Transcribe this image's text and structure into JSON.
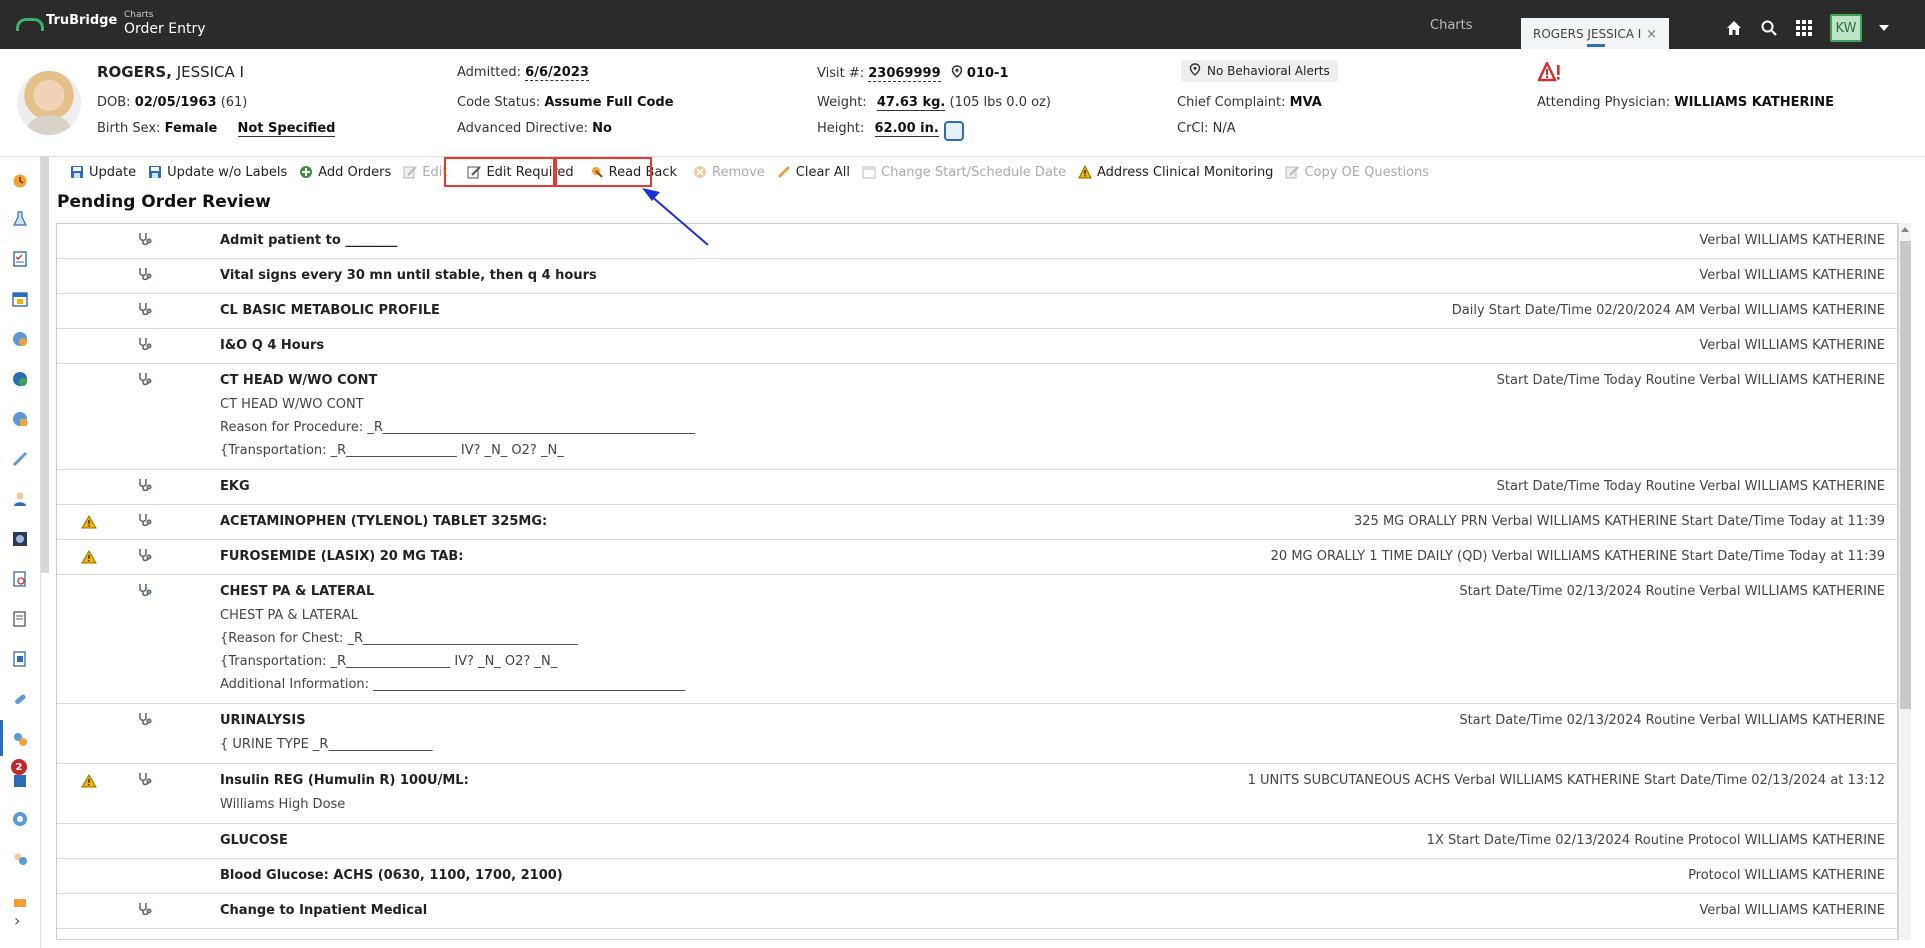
{
  "topbar": {
    "logo": "TruBridge",
    "crumb_small": "Charts",
    "crumb_main": "Order Entry",
    "tab_charts": "Charts",
    "tab_patient": "ROGERS JESSICA I",
    "tab_close": "×",
    "avatar_initials": "KW"
  },
  "patient": {
    "last_name": "ROGERS,",
    "first_name": " JESSICA I",
    "dob_label": "DOB:",
    "dob": "02/05/1963",
    "age": "(61)",
    "sex_label": "Birth Sex:",
    "sex": "Female",
    "gender": "Not Specified",
    "admitted_label": "Admitted:",
    "admitted": "6/6/2023",
    "code_status_label": "Code Status:",
    "code_status": "Assume Full Code",
    "adv_directive_label": "Advanced Directive:",
    "adv_directive": "No",
    "visit_label": "Visit #:",
    "visit": "23069999",
    "room": "010-1",
    "weight_label": "Weight:",
    "weight": "47.63 kg.",
    "weight_lbs": "(105 lbs 0.0 oz)",
    "height_label": "Height:",
    "height": "62.00 in.",
    "behavioral_alerts": "No Behavioral Alerts",
    "chief_complaint_label": "Chief Complaint:",
    "chief_complaint": "MVA",
    "crcl_label": "CrCl:",
    "crcl": "N/A",
    "attending_label": "Attending Physician:",
    "attending": "WILLIAMS KATHERINE"
  },
  "toolbar": {
    "update": "Update",
    "update_wo_labels": "Update w/o Labels",
    "add_orders": "Add Orders",
    "edit": "Edit",
    "edit_required": "Edit Required",
    "read_back": "Read Back",
    "remove": "Remove",
    "clear_all": "Clear All",
    "change_start": "Change Start/Schedule Date",
    "address_clinical": "Address Clinical Monitoring",
    "copy_oe": "Copy OE Questions"
  },
  "page_title": "Pending Order Review",
  "orders": [
    {
      "name": "Admit patient to ________",
      "detail": "Verbal WILLIAMS KATHERINE",
      "warn": false,
      "icon": true,
      "sub": []
    },
    {
      "name": "Vital signs every 30 mn until stable, then q 4 hours",
      "detail": "Verbal WILLIAMS KATHERINE",
      "warn": false,
      "icon": true,
      "sub": []
    },
    {
      "name": "CL BASIC METABOLIC PROFILE",
      "detail": "Daily Start Date/Time 02/20/2024 AM Verbal WILLIAMS KATHERINE",
      "warn": false,
      "icon": true,
      "sub": []
    },
    {
      "name": "I&O Q 4 Hours",
      "detail": "Verbal WILLIAMS KATHERINE",
      "warn": false,
      "icon": true,
      "sub": []
    },
    {
      "name": "CT HEAD W/WO CONT",
      "detail": "Start Date/Time Today Routine Verbal WILLIAMS KATHERINE",
      "warn": false,
      "icon": true,
      "sub": [
        "CT HEAD W/WO CONT",
        "Reason for Procedure: _R________________________________________________",
        "{Transportation: _R_________________ IV? _N_ O2? _N_"
      ]
    },
    {
      "name": "EKG",
      "detail": "Start Date/Time Today Routine Verbal WILLIAMS KATHERINE",
      "warn": false,
      "icon": true,
      "sub": []
    },
    {
      "name": "ACETAMINOPHEN (TYLENOL) TABLET 325MG:",
      "detail": "325 MG ORALLY PRN Verbal WILLIAMS KATHERINE Start Date/Time Today at 11:39",
      "warn": true,
      "icon": true,
      "sub": []
    },
    {
      "name": "FUROSEMIDE (LASIX) 20 MG TAB:",
      "detail": "20 MG ORALLY 1 TIME DAILY (QD) Verbal WILLIAMS KATHERINE Start Date/Time Today at 11:39",
      "warn": true,
      "icon": true,
      "sub": []
    },
    {
      "name": "CHEST PA & LATERAL",
      "detail": "Start Date/Time 02/13/2024 Routine Verbal WILLIAMS KATHERINE",
      "warn": false,
      "icon": true,
      "sub": [
        "CHEST PA & LATERAL",
        "{Reason for Chest: _R_________________________________",
        "{Transportation: _R________________ IV? _N_ O2? _N_",
        "Additional Information: ________________________________________________"
      ]
    },
    {
      "name": "URINALYSIS",
      "detail": "Start Date/Time 02/13/2024 Routine Verbal WILLIAMS KATHERINE",
      "warn": false,
      "icon": true,
      "sub": [
        "{ URINE TYPE _R________________"
      ]
    },
    {
      "name": "Insulin REG (Humulin R) 100U/ML:",
      "detail": "1 UNITS SUBCUTANEOUS ACHS Verbal WILLIAMS KATHERINE Start Date/Time 02/13/2024 at 13:12",
      "warn": true,
      "icon": true,
      "sub": [
        "Williams High Dose"
      ]
    },
    {
      "name": "GLUCOSE",
      "detail": "1X Start Date/Time 02/13/2024 Routine Protocol WILLIAMS KATHERINE",
      "warn": false,
      "icon": false,
      "sub": []
    },
    {
      "name": "Blood Glucose: ACHS (0630, 1100, 1700, 2100)",
      "detail": "Protocol WILLIAMS KATHERINE",
      "warn": false,
      "icon": false,
      "sub": []
    },
    {
      "name": "Change to Inpatient Medical",
      "detail": "Verbal WILLIAMS KATHERINE",
      "warn": false,
      "icon": true,
      "sub": []
    }
  ],
  "sidebar": {
    "badge_count": "2",
    "expand": "›"
  },
  "colors": {
    "topbar": "#2b2b2b",
    "accent": "#2d6db5",
    "highlight": "#e53935",
    "annotation_arrow": "#1a2fd6",
    "brand_green": "#3bb36a"
  }
}
